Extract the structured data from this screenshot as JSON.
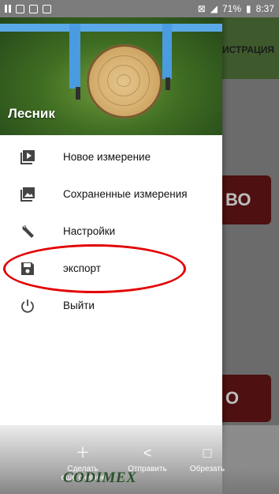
{
  "status_bar": {
    "battery": "71%",
    "time": "8:37"
  },
  "background": {
    "header_text": "ИСТРАЦИЯ",
    "button1_text": "ВО",
    "button2_text": "О"
  },
  "drawer": {
    "title": "Лесник",
    "items": [
      {
        "label": "Новое измерение",
        "icon": "video-library-icon"
      },
      {
        "label": "Сохраненные измерения",
        "icon": "photo-library-icon"
      },
      {
        "label": "Настройки",
        "icon": "wrench-icon"
      },
      {
        "label": "экспорт",
        "icon": "save-icon"
      },
      {
        "label": "Выйти",
        "icon": "power-icon"
      }
    ]
  },
  "annotation": {
    "color": "#e30000"
  },
  "bottom_actions": {
    "make_label_line1": "Сделать",
    "make_label_line2": "еще снимок",
    "send_label": "Отправить",
    "crop_label": "Обрезать"
  },
  "brand": "CODIMEX"
}
